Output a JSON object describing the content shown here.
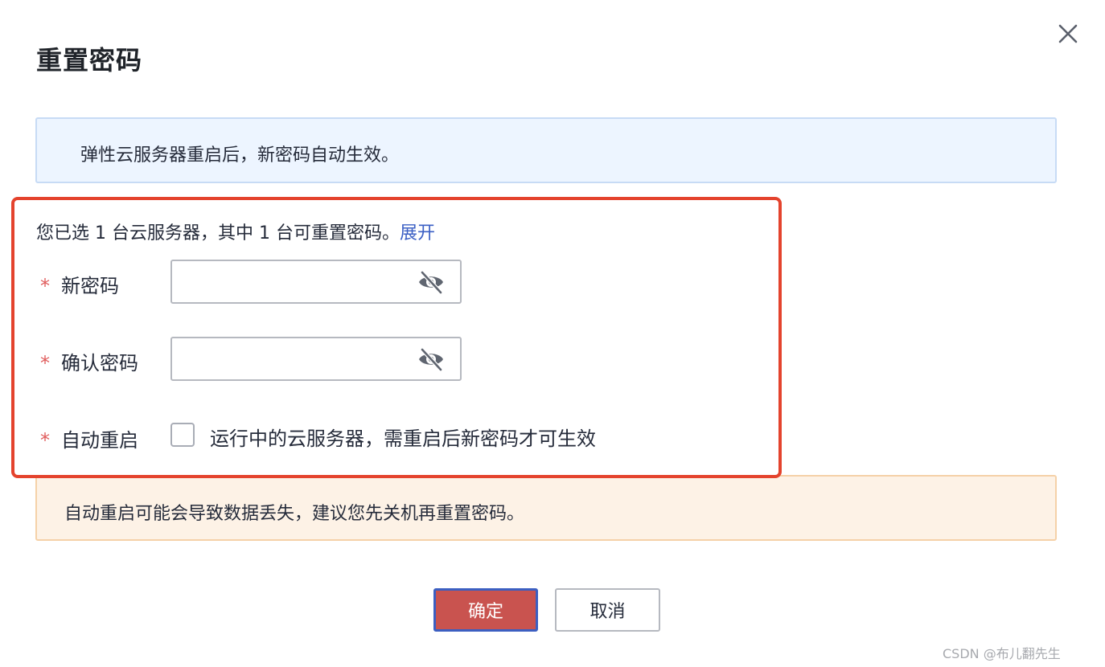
{
  "dialog": {
    "title": "重置密码",
    "close_icon": "close-icon"
  },
  "info": {
    "text": "弹性云服务器重启后，新密码自动生效。"
  },
  "selection": {
    "text": "您已选 1 台云服务器，其中 1 台可重置密码。",
    "expand_label": "展开"
  },
  "form": {
    "required_mark": "*",
    "new_password": {
      "label": "新密码",
      "value": "",
      "placeholder": "",
      "icon": "eye-slash-icon"
    },
    "confirm_password": {
      "label": "确认密码",
      "value": "",
      "placeholder": "",
      "icon": "eye-slash-icon"
    },
    "auto_restart": {
      "label": "自动重启",
      "checked": false,
      "description": "运行中的云服务器，需重启后新密码才可生效"
    }
  },
  "warning": {
    "text": "自动重启可能会导致数据丢失，建议您先关机再重置密码。"
  },
  "buttons": {
    "ok_label": "确定",
    "cancel_label": "取消"
  },
  "watermark": "CSDN @布儿翻先生",
  "colors": {
    "highlight_frame": "#e4432d",
    "ok_button": "#c9534f",
    "ok_button_focus": "#3c5fc1",
    "link": "#3b5fc4",
    "info_bg": "#edf5ff",
    "warn_bg": "#fdf2e6",
    "required": "#e05c5c"
  }
}
